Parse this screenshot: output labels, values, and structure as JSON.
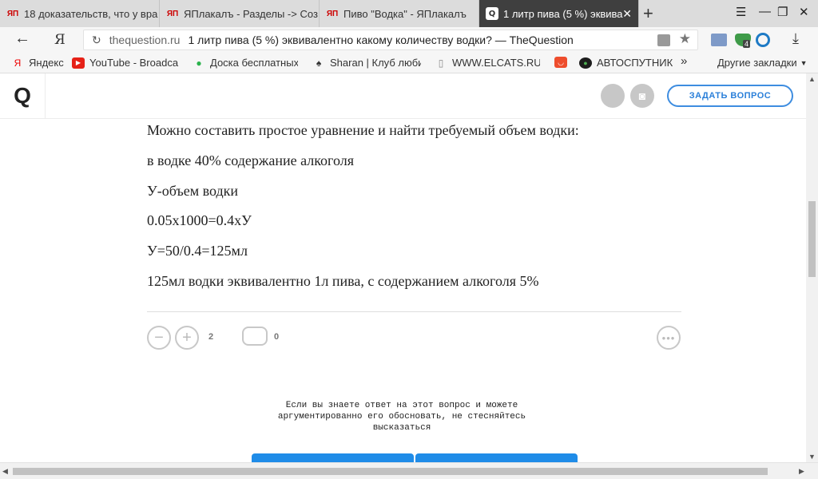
{
  "tabs": [
    {
      "label": "18 доказательств, что у вра",
      "favicon": "yaplakal-icon"
    },
    {
      "label": "ЯПлакалъ - Разделы -> Соз",
      "favicon": "yaplakal-icon"
    },
    {
      "label": "Пиво \"Водка\" - ЯПлакалъ",
      "favicon": "yaplakal-icon"
    },
    {
      "label": "1 литр пива (5 %) эквива",
      "favicon": "thequestion-icon",
      "active": true
    }
  ],
  "address": {
    "domain": "thequestion.ru",
    "title": "1 литр пива (5 %) эквивалентно какому количеству водки? — TheQuestion",
    "extension_badge": "4"
  },
  "bookmarks": [
    {
      "label": "Яндекс"
    },
    {
      "label": "YouTube - Broadca"
    },
    {
      "label": "Доска бесплатных"
    },
    {
      "label": "Sharan | Клуб люби"
    },
    {
      "label": "WWW.ELCATS.RU -"
    },
    {
      "label": ""
    },
    {
      "label": "АВТОСПУТНИК"
    },
    {
      "label": "»"
    }
  ],
  "other_bookmarks": "Другие закладки",
  "site": {
    "logo": "Q",
    "ask_button": "ЗАДАТЬ ВОПРОС"
  },
  "answer": {
    "paragraphs": [
      "Можно составить простое уравнение и найти требуемый объем водки:",
      "в водке 40% содержание алкоголя",
      "У-объем водки",
      "0.05х1000=0.4хУ",
      "У=50/0.4=125мл",
      "125мл водки эквивалентно 1л пива, с содержанием алкоголя 5%"
    ],
    "votes": "2",
    "comments": "0"
  },
  "prompt_text": "Если вы знаете ответ на этот вопрос и можете аргументированно его обосновать, не стесняйтесь высказаться",
  "colors": {
    "accent": "#2a7fd9",
    "active_tab": "#3f3f3f",
    "social_facebook": "#3b5998",
    "social_vk": "#5b7fa6",
    "social_ok": "#f58220",
    "social_twitter": "#55acee"
  }
}
